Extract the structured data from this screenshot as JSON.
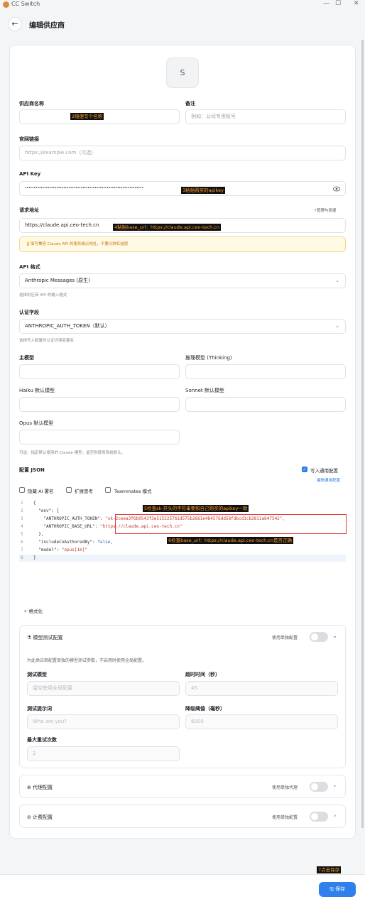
{
  "window": {
    "title": "CC Switch",
    "minimize": "—",
    "maximize": "☐",
    "close": "✕"
  },
  "header": {
    "back": "←",
    "title": "编辑供应商"
  },
  "avatar": {
    "letter": "S"
  },
  "form": {
    "name_label": "供应商名称",
    "note_label": "备注",
    "note_placeholder": "例如：公司专用账号",
    "website_label": "官网链接",
    "website_placeholder": "https://example.com（可选）",
    "apikey_label": "API Key",
    "apikey_value": "••••••••••••••••••••••••••••••••••••••••••••••••••••••••••••••••••••",
    "endpoint_label": "请求地址",
    "endpoint_action": "管理与测速",
    "endpoint_value": "https://claude.api.ceo-tech.cn",
    "endpoint_warning": "填写兼容 Claude API 的服务端点地址，不要以斜杠结尾",
    "api_format_label": "API 格式",
    "api_format_value": "Anthropic Messages (原生)",
    "api_format_hint": "选择供应商 API 的输入格式",
    "auth_label": "认证字段",
    "auth_value": "ANTHROPIC_AUTH_TOKEN（默认）",
    "auth_hint": "选择写入配置的认证环境变量名",
    "main_model_label": "主模型",
    "thinking_model_label": "推理模型 (Thinking)",
    "haiku_label": "Haiku 默认模型",
    "sonnet_label": "Sonnet 默认模型",
    "opus_label": "Opus 默认模型",
    "models_hint": "可选：指定默认使用的 Claude 模型，留空则使用系统默认。",
    "config_json_label": "配置 JSON",
    "write_common_label": "写入通用配置",
    "edit_common_link": "编辑通用配置",
    "hide_ai_sign": "隐藏 AI 署名",
    "extended_thinking": "扩展思考",
    "teammates_mode": "Teammates 模式",
    "format_button": "格式化"
  },
  "json_lines": [
    {
      "n": "1",
      "t": "{"
    },
    {
      "n": "2",
      "t": "  \"env\": {"
    },
    {
      "n": "3",
      "k": "    \"ANTHROPIC_AUTH_TOKEN\": ",
      "v": "\"sk-2ceea3f6b9543f3e515225761d575b2661e4b4576dd58fdbcd1cb2811ab47542\","
    },
    {
      "n": "4",
      "k": "    \"ANTHROPIC_BASE_URL\": ",
      "v": "\"https://claude.api.ceo-tech.cn\""
    },
    {
      "n": "5",
      "t": "  },"
    },
    {
      "n": "6",
      "k": "  \"includeCoAuthoredBy\": ",
      "kw": "false,"
    },
    {
      "n": "7",
      "k": "  \"model\": ",
      "v": "\"opus[1m]\""
    },
    {
      "n": "8",
      "t": "}"
    }
  ],
  "model_test": {
    "title": "模型测试配置",
    "toggle_label": "使用单独配置",
    "desc": "为此供应商配置单独的模型测试参数，不启用时使用全局配置。",
    "test_model_label": "测试模型",
    "test_model_placeholder": "留空使用全局配置",
    "timeout_label": "超时时间（秒）",
    "timeout_placeholder": "45",
    "prompt_label": "测试提示词",
    "prompt_placeholder": "Who are you?",
    "degrade_label": "降级阈值（毫秒）",
    "degrade_placeholder": "6000",
    "retry_label": "最大重试次数",
    "retry_placeholder": "2"
  },
  "proxy": {
    "title": "代理配置",
    "toggle_label": "使用单独代理"
  },
  "billing": {
    "title": "计费配置",
    "toggle_label": "使用单独配置"
  },
  "save_button": "保存",
  "annotations": {
    "a2": "2随便写个名称",
    "a3": "3粘贴购买的apikey",
    "a4": "4粘贴base_url：https://claude.api.ceo-tech.cn",
    "a5": "5检查sk-开头的字符串要和自己购买的apikey一致",
    "a6": "6检查base_url：https://claude.api.ceo-tech.cn是否正确",
    "a7": "7点击保存"
  }
}
